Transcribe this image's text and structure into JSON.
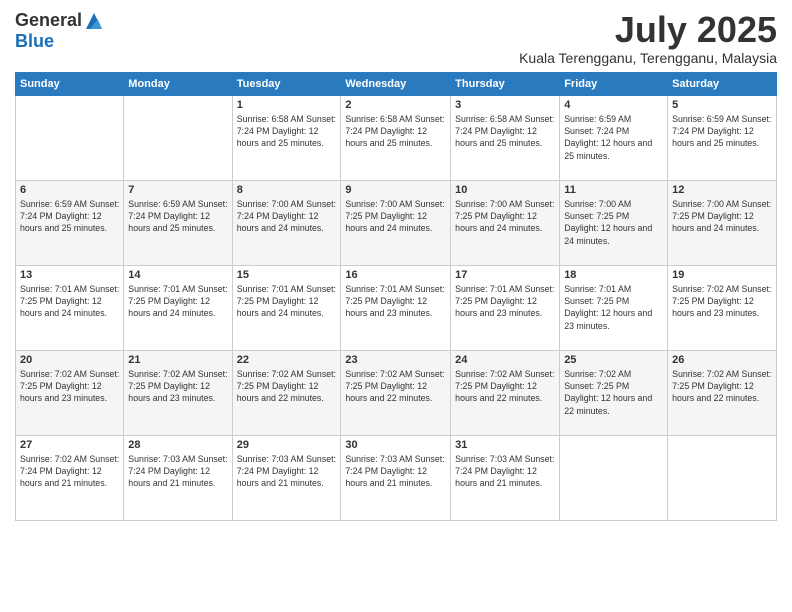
{
  "logo": {
    "general": "General",
    "blue": "Blue"
  },
  "title": {
    "month_year": "July 2025",
    "location": "Kuala Terengganu, Terengganu, Malaysia"
  },
  "weekdays": [
    "Sunday",
    "Monday",
    "Tuesday",
    "Wednesday",
    "Thursday",
    "Friday",
    "Saturday"
  ],
  "weeks": [
    [
      {
        "day": "",
        "detail": ""
      },
      {
        "day": "",
        "detail": ""
      },
      {
        "day": "1",
        "detail": "Sunrise: 6:58 AM\nSunset: 7:24 PM\nDaylight: 12 hours\nand 25 minutes."
      },
      {
        "day": "2",
        "detail": "Sunrise: 6:58 AM\nSunset: 7:24 PM\nDaylight: 12 hours\nand 25 minutes."
      },
      {
        "day": "3",
        "detail": "Sunrise: 6:58 AM\nSunset: 7:24 PM\nDaylight: 12 hours\nand 25 minutes."
      },
      {
        "day": "4",
        "detail": "Sunrise: 6:59 AM\nSunset: 7:24 PM\nDaylight: 12 hours\nand 25 minutes."
      },
      {
        "day": "5",
        "detail": "Sunrise: 6:59 AM\nSunset: 7:24 PM\nDaylight: 12 hours\nand 25 minutes."
      }
    ],
    [
      {
        "day": "6",
        "detail": "Sunrise: 6:59 AM\nSunset: 7:24 PM\nDaylight: 12 hours\nand 25 minutes."
      },
      {
        "day": "7",
        "detail": "Sunrise: 6:59 AM\nSunset: 7:24 PM\nDaylight: 12 hours\nand 25 minutes."
      },
      {
        "day": "8",
        "detail": "Sunrise: 7:00 AM\nSunset: 7:24 PM\nDaylight: 12 hours\nand 24 minutes."
      },
      {
        "day": "9",
        "detail": "Sunrise: 7:00 AM\nSunset: 7:25 PM\nDaylight: 12 hours\nand 24 minutes."
      },
      {
        "day": "10",
        "detail": "Sunrise: 7:00 AM\nSunset: 7:25 PM\nDaylight: 12 hours\nand 24 minutes."
      },
      {
        "day": "11",
        "detail": "Sunrise: 7:00 AM\nSunset: 7:25 PM\nDaylight: 12 hours\nand 24 minutes."
      },
      {
        "day": "12",
        "detail": "Sunrise: 7:00 AM\nSunset: 7:25 PM\nDaylight: 12 hours\nand 24 minutes."
      }
    ],
    [
      {
        "day": "13",
        "detail": "Sunrise: 7:01 AM\nSunset: 7:25 PM\nDaylight: 12 hours\nand 24 minutes."
      },
      {
        "day": "14",
        "detail": "Sunrise: 7:01 AM\nSunset: 7:25 PM\nDaylight: 12 hours\nand 24 minutes."
      },
      {
        "day": "15",
        "detail": "Sunrise: 7:01 AM\nSunset: 7:25 PM\nDaylight: 12 hours\nand 24 minutes."
      },
      {
        "day": "16",
        "detail": "Sunrise: 7:01 AM\nSunset: 7:25 PM\nDaylight: 12 hours\nand 23 minutes."
      },
      {
        "day": "17",
        "detail": "Sunrise: 7:01 AM\nSunset: 7:25 PM\nDaylight: 12 hours\nand 23 minutes."
      },
      {
        "day": "18",
        "detail": "Sunrise: 7:01 AM\nSunset: 7:25 PM\nDaylight: 12 hours\nand 23 minutes."
      },
      {
        "day": "19",
        "detail": "Sunrise: 7:02 AM\nSunset: 7:25 PM\nDaylight: 12 hours\nand 23 minutes."
      }
    ],
    [
      {
        "day": "20",
        "detail": "Sunrise: 7:02 AM\nSunset: 7:25 PM\nDaylight: 12 hours\nand 23 minutes."
      },
      {
        "day": "21",
        "detail": "Sunrise: 7:02 AM\nSunset: 7:25 PM\nDaylight: 12 hours\nand 23 minutes."
      },
      {
        "day": "22",
        "detail": "Sunrise: 7:02 AM\nSunset: 7:25 PM\nDaylight: 12 hours\nand 22 minutes."
      },
      {
        "day": "23",
        "detail": "Sunrise: 7:02 AM\nSunset: 7:25 PM\nDaylight: 12 hours\nand 22 minutes."
      },
      {
        "day": "24",
        "detail": "Sunrise: 7:02 AM\nSunset: 7:25 PM\nDaylight: 12 hours\nand 22 minutes."
      },
      {
        "day": "25",
        "detail": "Sunrise: 7:02 AM\nSunset: 7:25 PM\nDaylight: 12 hours\nand 22 minutes."
      },
      {
        "day": "26",
        "detail": "Sunrise: 7:02 AM\nSunset: 7:25 PM\nDaylight: 12 hours\nand 22 minutes."
      }
    ],
    [
      {
        "day": "27",
        "detail": "Sunrise: 7:02 AM\nSunset: 7:24 PM\nDaylight: 12 hours\nand 21 minutes."
      },
      {
        "day": "28",
        "detail": "Sunrise: 7:03 AM\nSunset: 7:24 PM\nDaylight: 12 hours\nand 21 minutes."
      },
      {
        "day": "29",
        "detail": "Sunrise: 7:03 AM\nSunset: 7:24 PM\nDaylight: 12 hours\nand 21 minutes."
      },
      {
        "day": "30",
        "detail": "Sunrise: 7:03 AM\nSunset: 7:24 PM\nDaylight: 12 hours\nand 21 minutes."
      },
      {
        "day": "31",
        "detail": "Sunrise: 7:03 AM\nSunset: 7:24 PM\nDaylight: 12 hours\nand 21 minutes."
      },
      {
        "day": "",
        "detail": ""
      },
      {
        "day": "",
        "detail": ""
      }
    ]
  ]
}
